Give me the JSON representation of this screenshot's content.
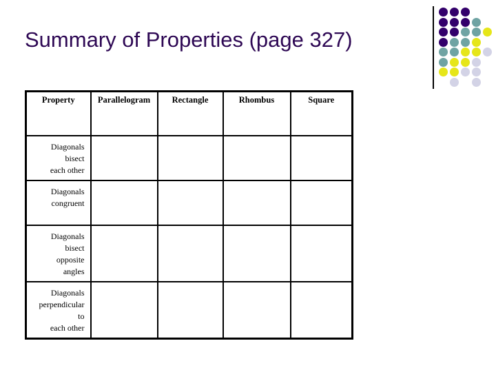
{
  "slide": {
    "title": "Summary of Properties (page 327)",
    "title_color": "#2e0854",
    "background_color": "#ffffff"
  },
  "decoration": {
    "name": "dot-grid",
    "rule_color": "#000000",
    "columns": 5,
    "rows": 8,
    "colors": {
      "purple": "#33006b",
      "teal": "#6fa3a3",
      "yellow": "#e6e619",
      "lavender": "#d3d3e6"
    },
    "grid": [
      [
        "purple",
        "purple",
        "purple",
        "",
        ""
      ],
      [
        "purple",
        "purple",
        "purple",
        "teal",
        ""
      ],
      [
        "purple",
        "purple",
        "teal",
        "teal",
        "yellow"
      ],
      [
        "purple",
        "teal",
        "teal",
        "yellow",
        ""
      ],
      [
        "teal",
        "teal",
        "yellow",
        "yellow",
        "lavender"
      ],
      [
        "teal",
        "yellow",
        "yellow",
        "lavender",
        ""
      ],
      [
        "yellow",
        "yellow",
        "lavender",
        "lavender",
        ""
      ],
      [
        "",
        "lavender",
        "",
        "lavender",
        ""
      ]
    ]
  },
  "table": {
    "name": "quadrilateral-properties-table",
    "headers": [
      "Property",
      "Parallelogram",
      "Rectangle",
      "Rhombus",
      "Square"
    ],
    "rows": [
      {
        "property_lines": [
          "Diagonals",
          "bisect",
          "each other"
        ],
        "parallelogram": "",
        "rectangle": "",
        "rhombus": "",
        "square": ""
      },
      {
        "property_lines": [
          "Diagonals",
          "congruent"
        ],
        "parallelogram": "",
        "rectangle": "",
        "rhombus": "",
        "square": ""
      },
      {
        "property_lines": [
          "Diagonals",
          "bisect",
          "opposite",
          "angles"
        ],
        "parallelogram": "",
        "rectangle": "",
        "rhombus": "",
        "square": ""
      },
      {
        "property_lines": [
          "Diagonals",
          "perpendicular",
          "to",
          "each other"
        ],
        "parallelogram": "",
        "rectangle": "",
        "rhombus": "",
        "square": ""
      }
    ]
  }
}
